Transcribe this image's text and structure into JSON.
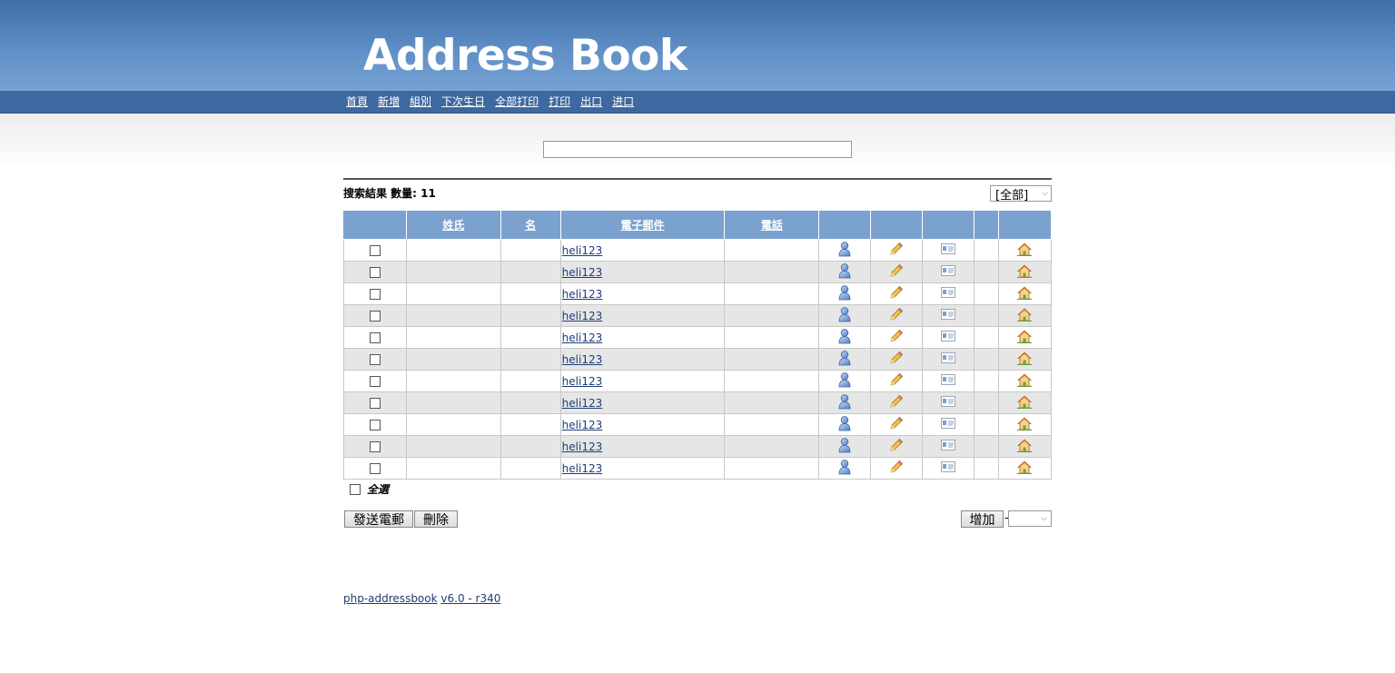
{
  "header": {
    "logo_text": "Address Book"
  },
  "nav": [
    "首頁",
    "新増",
    "組別",
    "下次生日",
    "全部打印",
    "打印",
    "出口",
    "进口"
  ],
  "search": {
    "value": ""
  },
  "results": {
    "label": "搜索結果 數量: 11",
    "group_filter": "[全部]"
  },
  "table": {
    "headers": [
      "",
      "姓氏",
      "名",
      "電子郵件",
      "電話",
      "",
      "",
      "",
      "",
      ""
    ],
    "rows": [
      {
        "email": "heli123"
      },
      {
        "email": "heli123"
      },
      {
        "email": "heli123"
      },
      {
        "email": "heli123"
      },
      {
        "email": "heli123"
      },
      {
        "email": "heli123"
      },
      {
        "email": "heli123"
      },
      {
        "email": "heli123"
      },
      {
        "email": "heli123"
      },
      {
        "email": "heli123"
      },
      {
        "email": "heli123"
      }
    ]
  },
  "select_all_label": "全選",
  "buttons": {
    "send_mail": "發送電郵",
    "delete": "刪除",
    "add": "增加"
  },
  "add_separator": "-",
  "footer": {
    "app": "php-addressbook",
    "version": "v6.0 - r340"
  },
  "colors": {
    "header_top": "#3f6ea8",
    "nav_bar": "#3e68a0",
    "table_header": "#7ba1cf",
    "row_alt": "#e6e6e6",
    "link": "#1d3d78"
  },
  "icons": [
    "person-icon",
    "pencil-icon",
    "vcard-icon",
    "home-icon"
  ]
}
